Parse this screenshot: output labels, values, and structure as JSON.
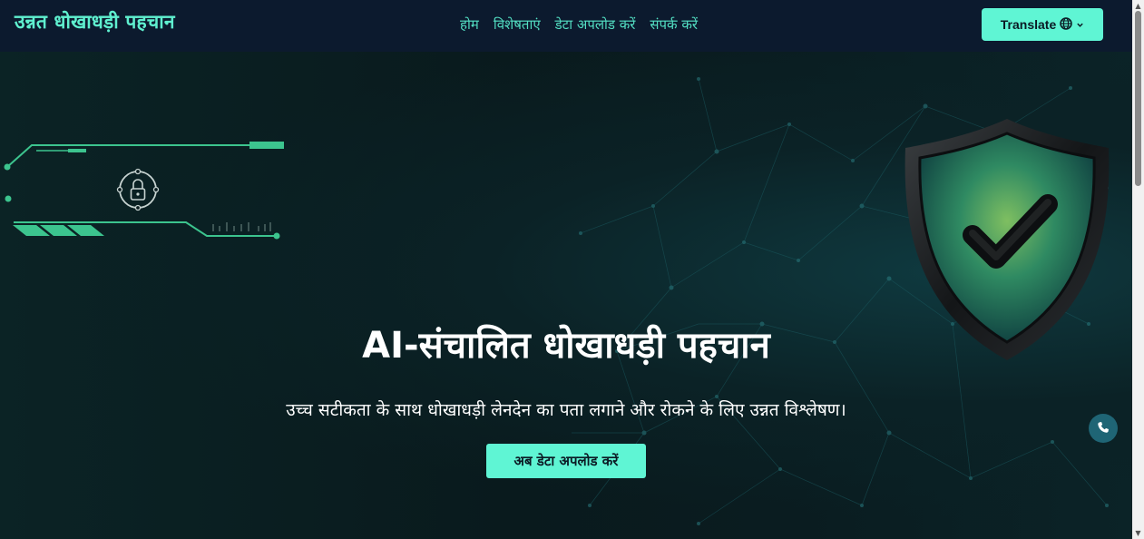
{
  "navbar": {
    "brand": "उन्नत धोखाधड़ी पहचान",
    "links": [
      {
        "label": "होम"
      },
      {
        "label": "विशेषताएं"
      },
      {
        "label": "डेटा अपलोड करें"
      },
      {
        "label": "संपर्क करें"
      }
    ],
    "translate_label": "Translate"
  },
  "hero": {
    "title": "AI-संचालित धोखाधड़ी पहचान",
    "subtitle": "उच्च सटीकता के साथ धोखाधड़ी लेनदेन का पता लगाने और रोकने के लिए उन्नत विश्लेषण।",
    "cta_label": "अब डेटा अपलोड करें"
  },
  "icons": {
    "translate": "globe-icon",
    "dropdown": "chevron-down-icon",
    "lock": "lock-icon",
    "shield": "shield-check-icon",
    "call": "phone-icon"
  },
  "colors": {
    "accent": "#5ff5d4",
    "navbar_bg": "#0c1a2e",
    "hero_bg": "#0a1c1f",
    "call_button": "#1f6575"
  }
}
